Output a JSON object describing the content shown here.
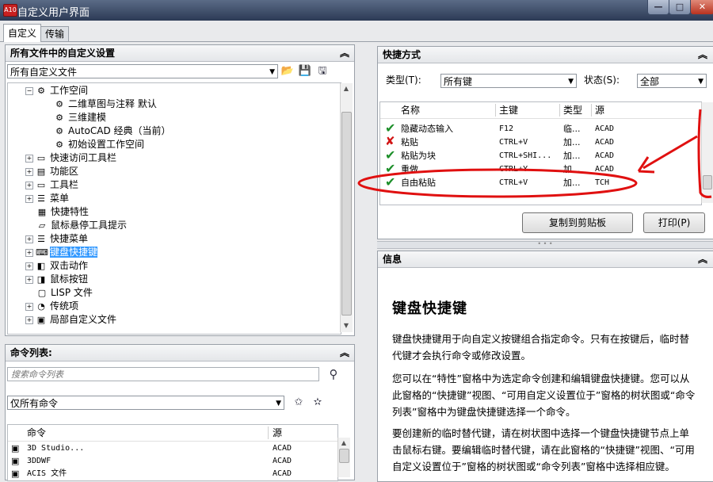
{
  "window": {
    "app_icon_text": "A10",
    "title": "自定义用户界面",
    "minimize": "—",
    "maximize": "□",
    "close": "✕"
  },
  "tabs": [
    "自定义",
    "传输"
  ],
  "customize_panel": {
    "header": "所有文件中的自定义设置",
    "file_select": "所有自定义文件",
    "tree": [
      {
        "label": "工作空间",
        "icon": "workspace-icon",
        "expander": "−"
      },
      {
        "label": "二维草图与注释 默认",
        "icon": "gear-icon"
      },
      {
        "label": "三维建模",
        "icon": "gear-icon"
      },
      {
        "label": "AutoCAD 经典（当前）",
        "icon": "gear-icon"
      },
      {
        "label": "初始设置工作空间",
        "icon": "gear-icon"
      },
      {
        "label": "快速访问工具栏",
        "icon": "toolbar-icon",
        "expander": "+"
      },
      {
        "label": "功能区",
        "icon": "ribbon-icon",
        "expander": "+"
      },
      {
        "label": "工具栏",
        "icon": "toolbar-icon",
        "expander": "+"
      },
      {
        "label": "菜单",
        "icon": "menu-icon",
        "expander": "+"
      },
      {
        "label": "快捷特性",
        "icon": "properties-icon"
      },
      {
        "label": "鼠标悬停工具提示",
        "icon": "tooltip-icon"
      },
      {
        "label": "快捷菜单",
        "icon": "menu-icon",
        "expander": "+"
      },
      {
        "label": "键盘快捷键",
        "icon": "keyboard-icon",
        "expander": "+",
        "selected": true
      },
      {
        "label": "双击动作",
        "icon": "doubleclick-icon",
        "expander": "+"
      },
      {
        "label": "鼠标按钮",
        "icon": "mouse-icon",
        "expander": "+"
      },
      {
        "label": "LISP 文件",
        "icon": "lisp-icon"
      },
      {
        "label": "传统项",
        "icon": "legacy-icon",
        "expander": "+"
      },
      {
        "label": "局部自定义文件",
        "icon": "cui-icon",
        "expander": "+"
      }
    ]
  },
  "command_panel": {
    "header": "命令列表:",
    "search_placeholder": "搜索命令列表",
    "filter_select": "仅所有命令",
    "columns": [
      "命令",
      "源"
    ],
    "rows": [
      {
        "name": "3D Studio...",
        "source": "ACAD"
      },
      {
        "name": "3DDWF",
        "source": "ACAD"
      },
      {
        "name": "ACIS 文件",
        "source": "ACAD"
      }
    ]
  },
  "shortcuts_panel": {
    "header": "快捷方式",
    "type_label": "类型(T):",
    "type_value": "所有键",
    "status_label": "状态(S):",
    "status_value": "全部",
    "columns": [
      "名称",
      "主键",
      "类型",
      "源"
    ],
    "rows": [
      {
        "status": "check",
        "name": "隐藏动态输入",
        "key": "F12",
        "type": "临...",
        "source": "ACAD"
      },
      {
        "status": "cross",
        "name": "粘贴",
        "key": "CTRL+V",
        "type": "加...",
        "source": "ACAD"
      },
      {
        "status": "check",
        "name": "粘贴为块",
        "key": "CTRL+SHI...",
        "type": "加...",
        "source": "ACAD"
      },
      {
        "status": "check",
        "name": "重做",
        "key": "CTRL+Y",
        "type": "加...",
        "source": "ACAD"
      },
      {
        "status": "check",
        "name": "自由粘贴",
        "key": "CTRL+V",
        "type": "加...",
        "source": "TCH"
      }
    ],
    "copy_button": "复制到剪贴板",
    "print_button": "打印(P)"
  },
  "info_panel": {
    "header": "信息",
    "title": "键盘快捷键",
    "paragraphs": [
      "键盘快捷键用于向自定义按键组合指定命令。只有在按键后，临时替代键才会执行命令或修改设置。",
      "您可以在“特性”窗格中为选定命令创建和编辑键盘快捷键。您可以从此窗格的“快捷键”视图、“可用自定义设置位于”窗格的树状图或“命令列表”窗格中为键盘快捷键选择一个命令。",
      "要创建新的临时替代键，请在树状图中选择一个键盘快捷键节点上单击鼠标右键。要编辑临时替代键，请在此窗格的“快捷键”视图、“可用自定义设置位于”窗格的树状图或“命令列表”窗格中选择相应键。"
    ]
  },
  "colors": {
    "selection": "#3399ff",
    "annotation": "#e01010",
    "check": "#1d8f2a",
    "cross": "#d21515"
  }
}
